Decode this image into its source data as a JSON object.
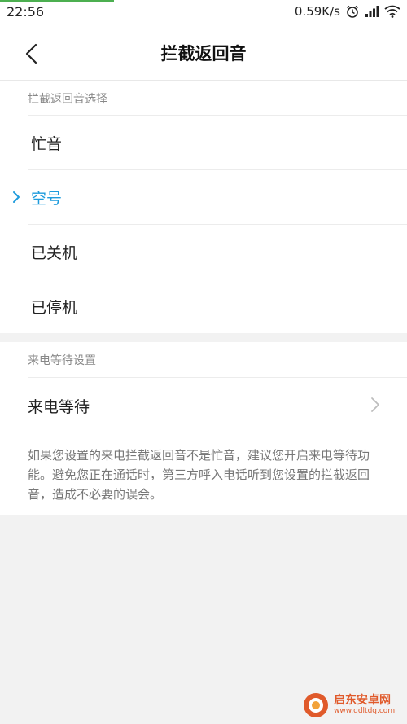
{
  "status_bar": {
    "time": "22:56",
    "net_speed": "0.59K/s"
  },
  "header": {
    "title": "拦截返回音"
  },
  "section_tone": {
    "caption": "拦截返回音选择",
    "options": [
      {
        "label": "忙音",
        "selected": false
      },
      {
        "label": "空号",
        "selected": true
      },
      {
        "label": "已关机",
        "selected": false
      },
      {
        "label": "已停机",
        "selected": false
      }
    ]
  },
  "section_wait": {
    "caption": "来电等待设置",
    "item_label": "来电等待",
    "description": "如果您设置的来电拦截返回音不是忙音，建议您开启来电等待功能。避免您正在通话时，第三方呼入电话听到您设置的拦截返回音，造成不必要的误会。"
  },
  "watermark": {
    "name": "启东安卓网",
    "url": "www.qdltdq.com"
  },
  "colors": {
    "accent": "#1e9bdc",
    "progress": "#4caf50",
    "watermark": "#e05a2b"
  }
}
